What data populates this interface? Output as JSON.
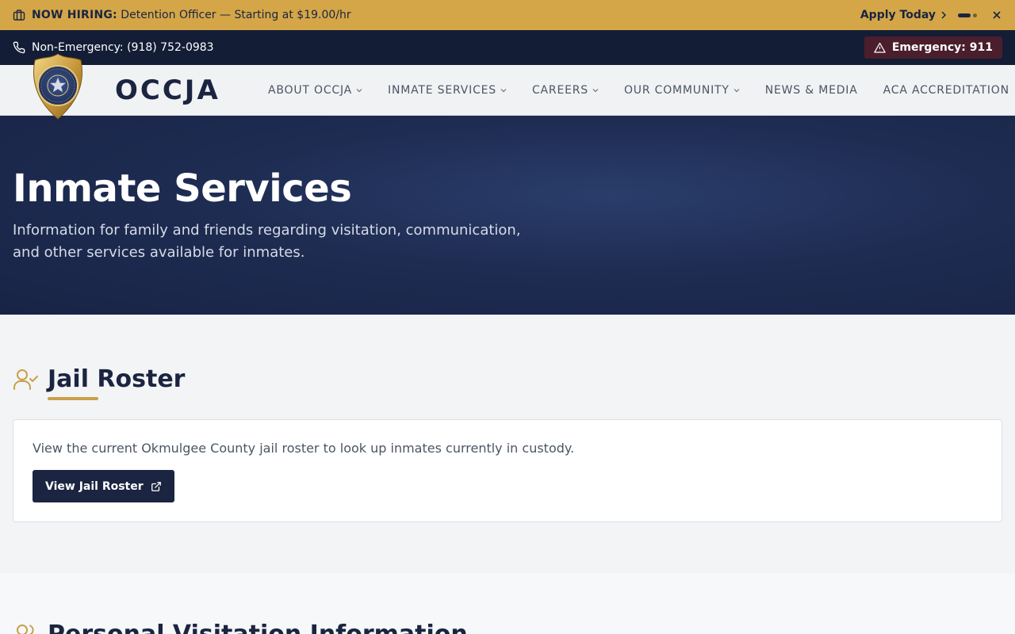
{
  "hiring_banner": {
    "label": "NOW HIRING:",
    "message": " Detention Officer — Starting at $19.00/hr",
    "apply_label": "Apply Today"
  },
  "utility_bar": {
    "phone_label": "Non-Emergency: (918) 752-0983",
    "emergency_label": "Emergency: 911"
  },
  "nav": {
    "brand": "OCCJA",
    "items": [
      {
        "label": "ABOUT OCCJA",
        "has_dropdown": true
      },
      {
        "label": "INMATE SERVICES",
        "has_dropdown": true
      },
      {
        "label": "CAREERS",
        "has_dropdown": true
      },
      {
        "label": "OUR COMMUNITY",
        "has_dropdown": true
      },
      {
        "label": "NEWS & MEDIA",
        "has_dropdown": false
      },
      {
        "label": "ACA ACCREDITATION",
        "has_dropdown": false
      }
    ]
  },
  "hero": {
    "title": "Inmate Services",
    "subtitle": "Information for family and friends regarding visitation, communication, and other services available for inmates."
  },
  "jail_roster": {
    "title": "Jail Roster",
    "description": "View the current Okmulgee County jail roster to look up inmates currently in custody.",
    "button_label": "View Jail Roster"
  },
  "visitation": {
    "title": "Personal Visitation Information"
  },
  "colors": {
    "banner_gold": "#d4a648",
    "navy": "#1b2541",
    "accent_gold": "#c9a04a",
    "emergency_bg": "#4a1e2c"
  }
}
